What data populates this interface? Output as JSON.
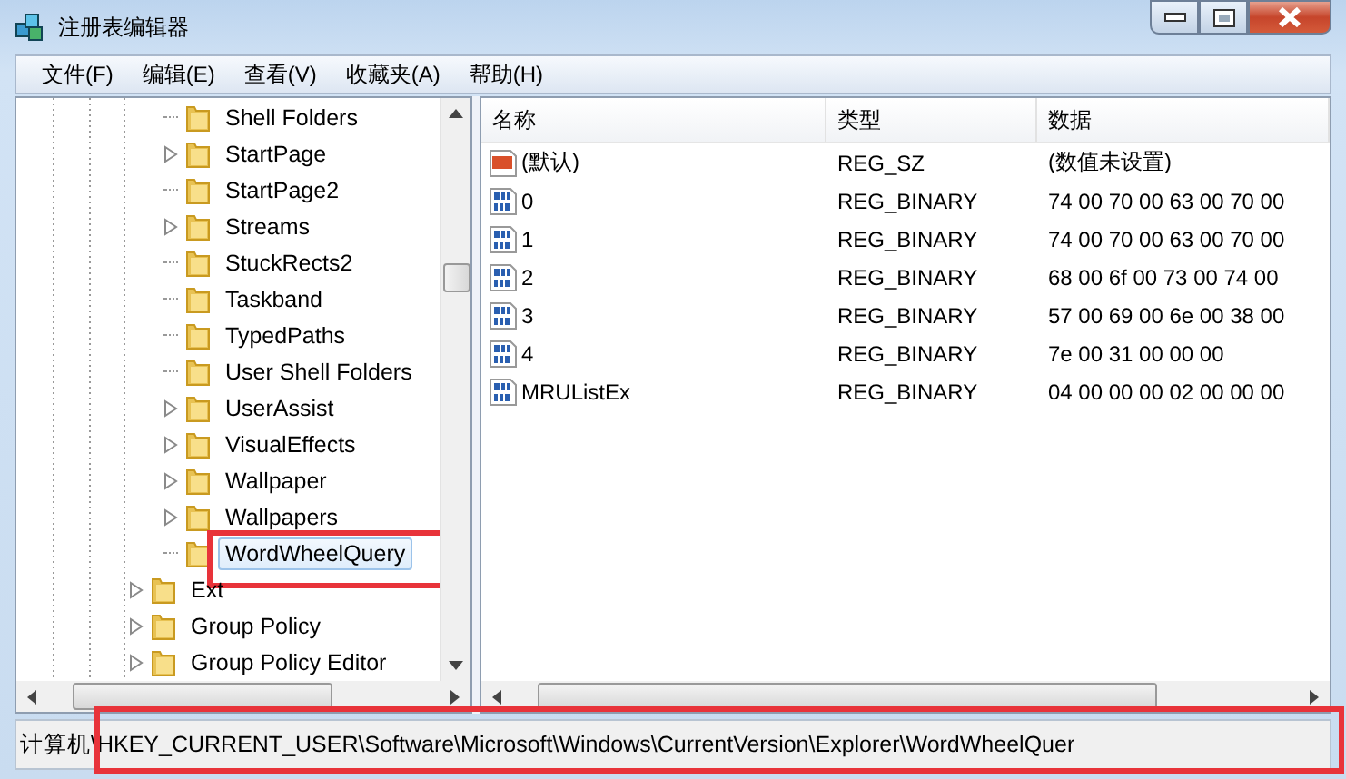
{
  "window": {
    "title": "注册表编辑器"
  },
  "menu": [
    "文件(F)",
    "编辑(E)",
    "查看(V)",
    "收藏夹(A)",
    "帮助(H)"
  ],
  "tree": {
    "items": [
      {
        "children": [
          {
            "label": "Shell Folders",
            "expandable": false,
            "selected": false,
            "highlighted": false
          },
          {
            "label": "StartPage",
            "expandable": true,
            "selected": false,
            "highlighted": false
          },
          {
            "label": "StartPage2",
            "expandable": false,
            "selected": false,
            "highlighted": false
          },
          {
            "label": "Streams",
            "expandable": true,
            "selected": false,
            "highlighted": false
          },
          {
            "label": "StuckRects2",
            "expandable": false,
            "selected": false,
            "highlighted": false
          },
          {
            "label": "Taskband",
            "expandable": false,
            "selected": false,
            "highlighted": false
          },
          {
            "label": "TypedPaths",
            "expandable": false,
            "selected": false,
            "highlighted": false
          },
          {
            "label": "User Shell Folders",
            "expandable": false,
            "selected": false,
            "highlighted": false
          },
          {
            "label": "UserAssist",
            "expandable": true,
            "selected": false,
            "highlighted": false
          },
          {
            "label": "VisualEffects",
            "expandable": true,
            "selected": false,
            "highlighted": false
          },
          {
            "label": "Wallpaper",
            "expandable": true,
            "selected": false,
            "highlighted": false
          },
          {
            "label": "Wallpapers",
            "expandable": true,
            "selected": false,
            "highlighted": false
          },
          {
            "label": "WordWheelQuery",
            "expandable": false,
            "selected": true,
            "highlighted": true
          }
        ]
      },
      {
        "label": "Ext",
        "expandable": true,
        "selected": false,
        "highlighted": false
      },
      {
        "label": "Group Policy",
        "expandable": true,
        "selected": false,
        "highlighted": false
      },
      {
        "label": "Group Policy Editor",
        "expandable": true,
        "selected": false,
        "highlighted": false
      }
    ]
  },
  "table": {
    "columns": [
      "名称",
      "类型",
      "数据"
    ],
    "rows": [
      {
        "kind": "string",
        "name": "(默认)",
        "type": "REG_SZ",
        "data": "(数值未设置)"
      },
      {
        "kind": "binary",
        "name": "0",
        "type": "REG_BINARY",
        "data": "74 00 70 00 63 00 70 00"
      },
      {
        "kind": "binary",
        "name": "1",
        "type": "REG_BINARY",
        "data": "74 00 70 00 63 00 70 00"
      },
      {
        "kind": "binary",
        "name": "2",
        "type": "REG_BINARY",
        "data": "68 00 6f 00 73 00 74 00"
      },
      {
        "kind": "binary",
        "name": "3",
        "type": "REG_BINARY",
        "data": "57 00 69 00 6e 00 38 00"
      },
      {
        "kind": "binary",
        "name": "4",
        "type": "REG_BINARY",
        "data": "7e 00 31 00 00 00"
      },
      {
        "kind": "binary",
        "name": "MRUListEx",
        "type": "REG_BINARY",
        "data": "04 00 00 00 02 00 00 00"
      }
    ]
  },
  "status_bar": {
    "path": "计算机\\HKEY_CURRENT_USER\\Software\\Microsoft\\Windows\\CurrentVersion\\Explorer\\WordWheelQuer",
    "highlighted": true
  }
}
